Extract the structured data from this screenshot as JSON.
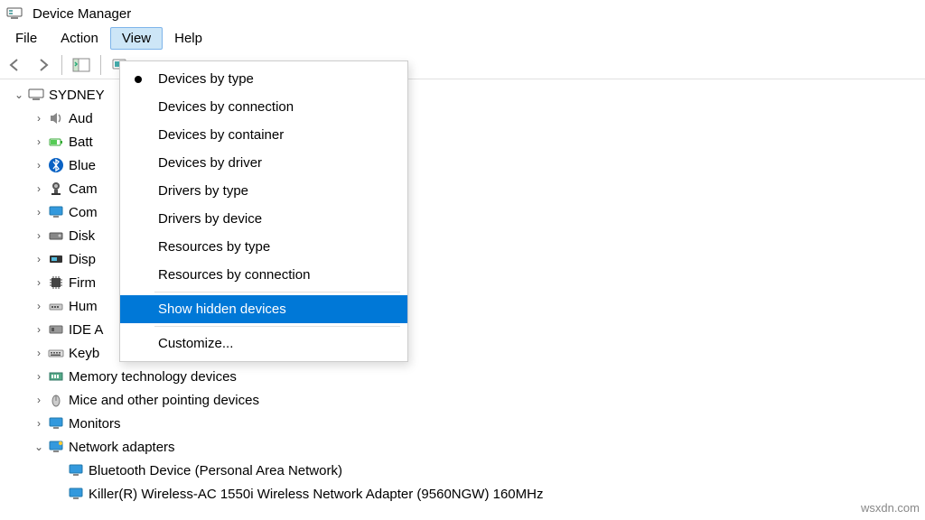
{
  "window": {
    "title": "Device Manager"
  },
  "menus": {
    "file": "File",
    "action": "Action",
    "view": "View",
    "help": "Help"
  },
  "view_menu": {
    "devices_by_type": "Devices by type",
    "devices_by_connection": "Devices by connection",
    "devices_by_container": "Devices by container",
    "devices_by_driver": "Devices by driver",
    "drivers_by_type": "Drivers by type",
    "drivers_by_device": "Drivers by device",
    "resources_by_type": "Resources by type",
    "resources_by_connection": "Resources by connection",
    "show_hidden_devices": "Show hidden devices",
    "customize": "Customize..."
  },
  "tree": {
    "root": "SYDNEY",
    "audio": "Aud",
    "batteries": "Batt",
    "bluetooth": "Blue",
    "cameras": "Cam",
    "computer": "Com",
    "disk": "Disk",
    "display": "Disp",
    "firmware": "Firm",
    "hid": "Hum",
    "ide": "IDE A",
    "keyboards": "Keyb",
    "memory": "Memory technology devices",
    "mice": "Mice and other pointing devices",
    "monitors": "Monitors",
    "network": "Network adapters",
    "net1": "Bluetooth Device (Personal Area Network)",
    "net2": "Killer(R) Wireless-AC 1550i Wireless Network Adapter (9560NGW) 160MHz"
  },
  "watermark": "wsxdn.com"
}
